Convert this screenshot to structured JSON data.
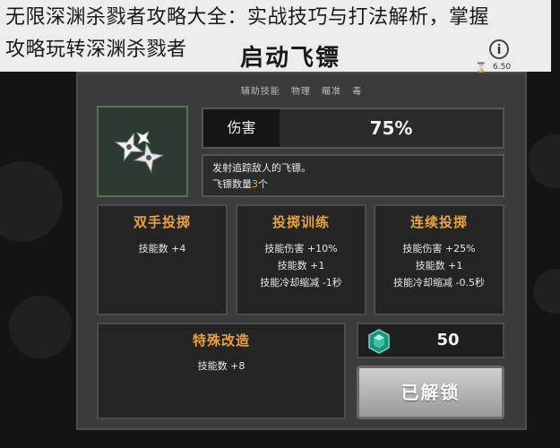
{
  "banner": {
    "line1": "无限深渊杀戮者攻略大全：实战技巧与打法解析，掌握",
    "line2": "攻略玩转深渊杀戮者"
  },
  "panel": {
    "title": "启动飞镖",
    "info_icon": "info-icon",
    "timer_icon": "hourglass-icon",
    "timer_value": "6.50",
    "tags": [
      "辅助技能",
      "物理",
      "瞄准",
      "毒"
    ]
  },
  "skill": {
    "icon": "shuriken-icon",
    "stat_label": "伤害",
    "stat_value": "75%",
    "desc_line1": "发射追踪敌人的飞镖。",
    "desc_line2_prefix": "飞镖数量",
    "desc_line2_value": "3",
    "desc_line2_suffix": "个"
  },
  "upgrades": [
    {
      "title": "双手投掷",
      "lines": [
        "技能数 +4"
      ]
    },
    {
      "title": "投掷训练",
      "lines": [
        "技能伤害 +10%",
        "技能数 +1",
        "技能冷却缩减 -1秒"
      ]
    },
    {
      "title": "连续投掷",
      "lines": [
        "技能伤害 +25%",
        "技能数 +1",
        "技能冷却缩减 -0.5秒"
      ]
    }
  ],
  "special": {
    "title": "特殊改造",
    "line": "技能数 +8"
  },
  "cost": {
    "icon": "gem-icon",
    "value": "50"
  },
  "unlock_button": {
    "label": "已解锁"
  },
  "colors": {
    "accent": "#e7a23a",
    "panel": "#3b3b3b",
    "card": "#242424"
  }
}
